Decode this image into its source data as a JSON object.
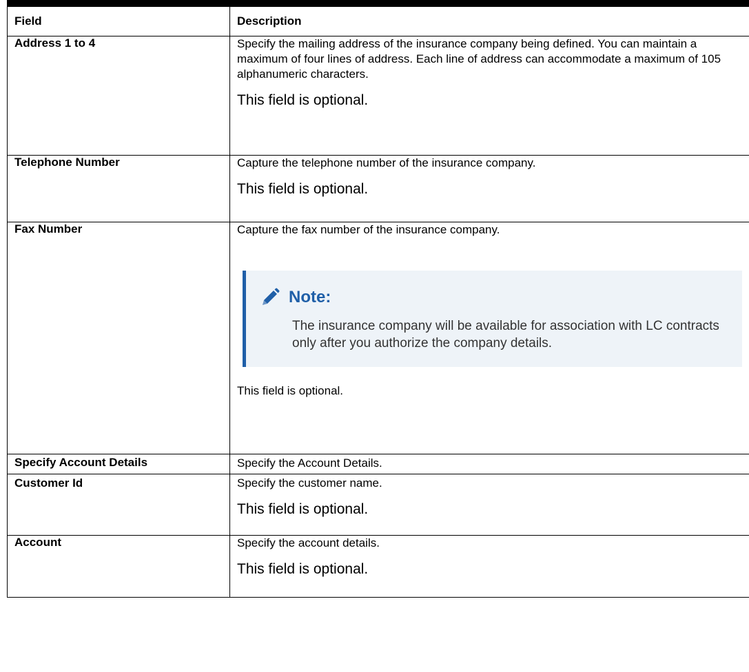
{
  "table": {
    "headers": {
      "field": "Field",
      "description": "Description"
    },
    "rows": [
      {
        "field": "Address 1 to 4",
        "description": "Specify the mailing address of the insurance company being defined. You can maintain a maximum of four lines of address. Each line of address can accommodate a maximum of 105 alphanumeric characters.",
        "optional": "This field is optional."
      },
      {
        "field": "Telephone Number",
        "description": "Capture the telephone number of the insurance company.",
        "optional": "This field is optional."
      },
      {
        "field": "Fax Number",
        "description": "Capture the fax number of the insurance company.",
        "note": {
          "icon": "pencil-icon",
          "label": "Note:",
          "text": "The insurance company will be available for association with LC contracts only after you authorize the company details."
        },
        "optional": "This field is optional."
      },
      {
        "field": "Specify Account Details",
        "description": "Specify the Account Details."
      },
      {
        "field": "Customer Id",
        "description": "Specify the customer name.",
        "optional": "This field is optional."
      },
      {
        "field": "Account",
        "description": "Specify the account details.",
        "optional": "This field is optional."
      }
    ]
  },
  "colors": {
    "note_accent": "#1f5fa8",
    "note_background": "#eef3f8"
  }
}
